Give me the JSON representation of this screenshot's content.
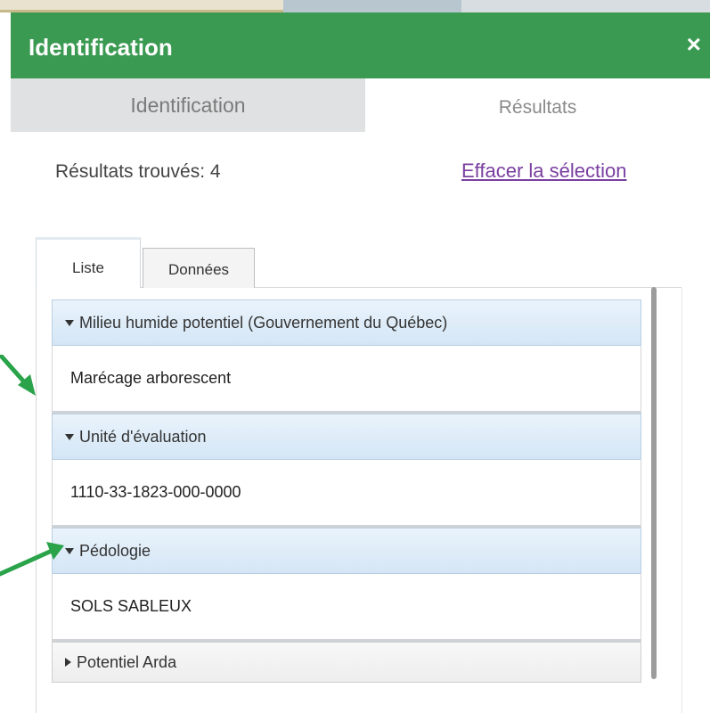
{
  "panel": {
    "title": "Identification",
    "close_glyph": "×"
  },
  "tabs": {
    "identification": "Identification",
    "results": "Résultats"
  },
  "results": {
    "count_text": "Résultats trouvés: 4",
    "clear_link": "Effacer la sélection"
  },
  "subtabs": {
    "liste": "Liste",
    "donnees": "Données"
  },
  "groups": [
    {
      "header": "Milieu humide potentiel (Gouvernement du Québec)",
      "expanded": true,
      "item": "Marécage arborescent"
    },
    {
      "header": "Unité d'évaluation",
      "expanded": true,
      "item": "1110-33-1823-000-0000"
    },
    {
      "header": "Pédologie",
      "expanded": true,
      "item": "SOLS SABLEUX"
    },
    {
      "header": "Potentiel Arda",
      "expanded": false
    }
  ],
  "colors": {
    "titlebar": "#3b9a52",
    "annotation_arrow": "#2aa34a",
    "link": "#7a3fa0"
  },
  "icons": {
    "close": "close-icon",
    "expanded": "caret-down-icon",
    "collapsed": "caret-right-icon",
    "annotation": "arrow-annotation-icon"
  }
}
